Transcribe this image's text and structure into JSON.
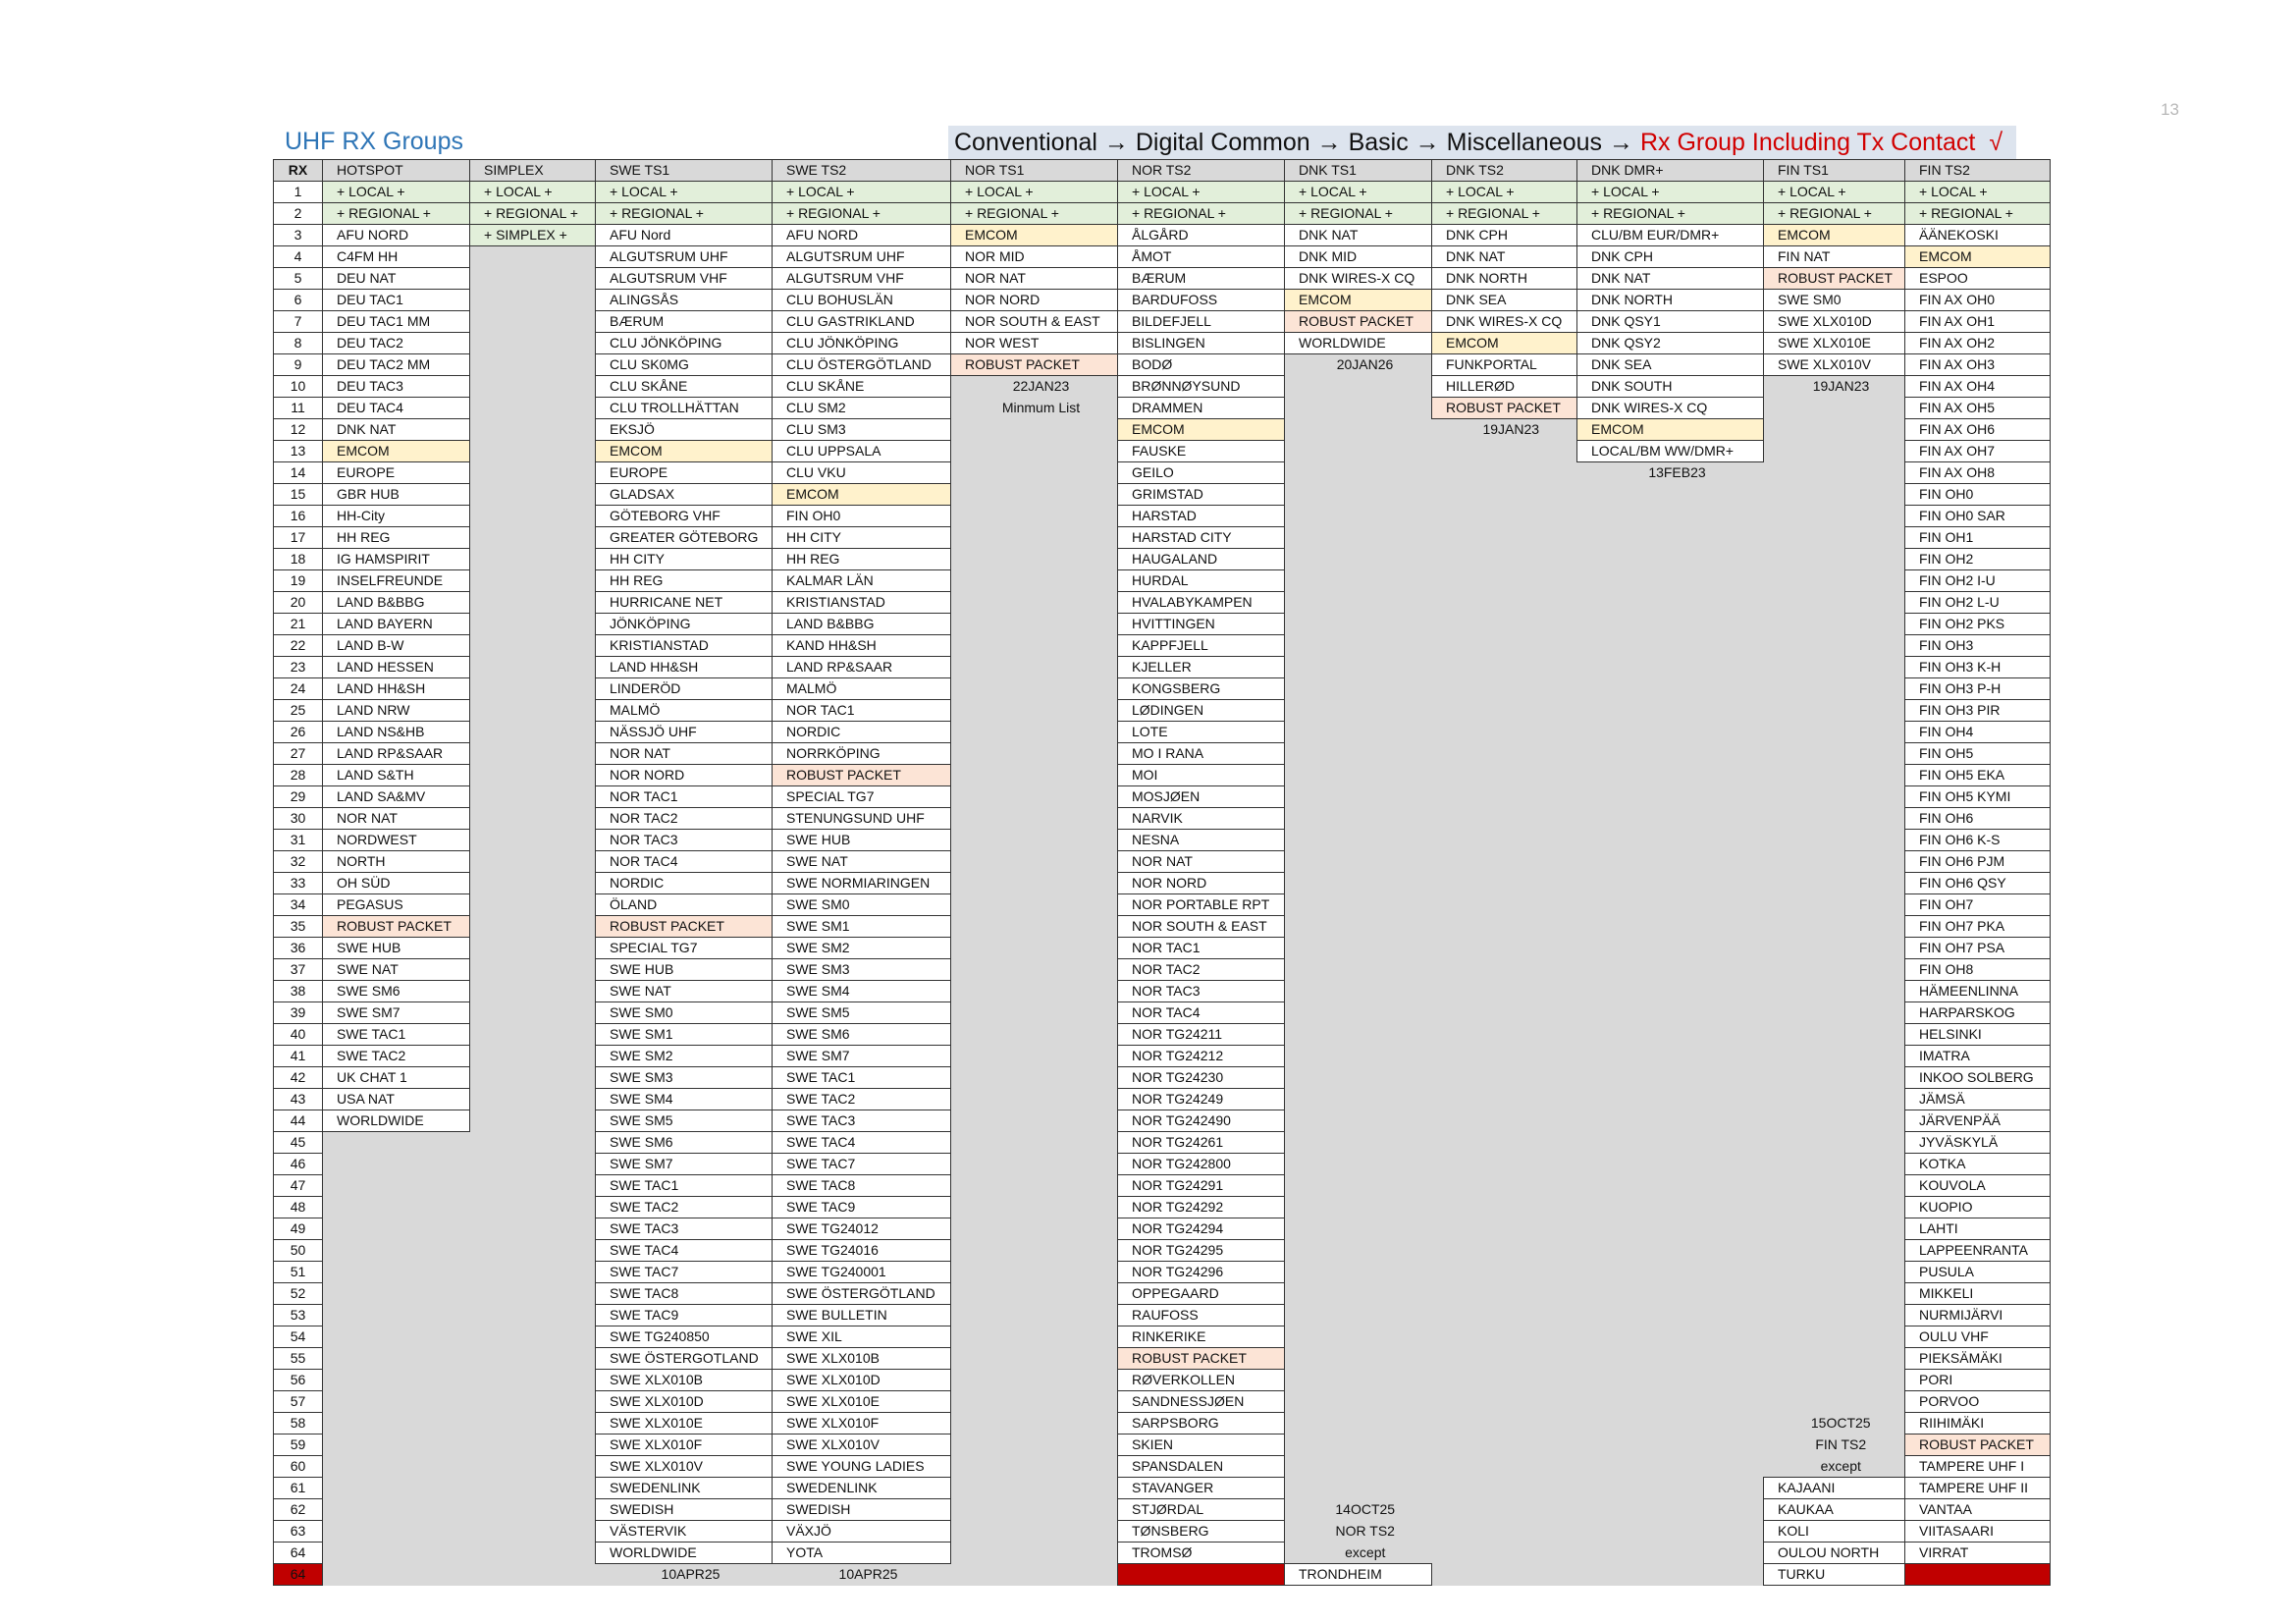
{
  "page_number": "13",
  "title": "UHF RX Groups",
  "menu_path": {
    "p1": "Conventional",
    "p2": "Digital Common",
    "p3": "Basic",
    "p4": "Miscellaneous",
    "highlight": "Rx Group Including Tx Contact",
    "arrow": " → ",
    "check": "√"
  },
  "columns": [
    "RX",
    "HOTSPOT",
    "SIMPLEX",
    "SWE TS1",
    "SWE TS2",
    "NOR TS1",
    "NOR TS2",
    "DNK TS1",
    "DNK TS2",
    "DNK DMR+",
    "FIN TS1",
    "FIN TS2"
  ],
  "lists": [
    [
      "+ LOCAL +",
      "+ REGIONAL +",
      "AFU NORD",
      "C4FM HH",
      "DEU NAT",
      "DEU TAC1",
      "DEU TAC1 MM",
      "DEU TAC2",
      "DEU TAC2 MM",
      "DEU TAC3",
      "DEU TAC4",
      "DNK NAT",
      "EMCOM",
      "EUROPE",
      "GBR HUB",
      "HH-City",
      "HH REG",
      "IG HAMSPIRIT",
      "INSELFREUNDE",
      "LAND B&BBG",
      "LAND BAYERN",
      "LAND B-W",
      "LAND HESSEN",
      "LAND HH&SH",
      "LAND NRW",
      "LAND NS&HB",
      "LAND RP&SAAR",
      "LAND S&TH",
      "LAND SA&MV",
      "NOR NAT",
      "NORDWEST",
      "NORTH",
      "OH SÜD",
      "PEGASUS",
      "ROBUST PACKET",
      "SWE HUB",
      "SWE NAT",
      "SWE SM6",
      "SWE SM7",
      "SWE TAC1",
      "SWE TAC2",
      "UK CHAT 1",
      "USA NAT",
      "WORLDWIDE"
    ],
    [
      "+ LOCAL +",
      "+ REGIONAL +",
      "+ SIMPLEX +"
    ],
    [
      "+ LOCAL +",
      "+ REGIONAL +",
      "AFU Nord",
      "ALGUTSRUM UHF",
      "ALGUTSRUM VHF",
      "ALINGSÅS",
      "BÆRUM",
      "CLU JÖNKÖPING",
      "CLU SK0MG",
      "CLU SKÅNE",
      "CLU TROLLHÄTTAN",
      "EKSJÖ",
      "EMCOM",
      "EUROPE",
      "GLADSAX",
      "GÖTEBORG VHF",
      "GREATER GÖTEBORG",
      "HH CITY",
      "HH REG",
      "HURRICANE NET",
      "JÖNKÖPING",
      "KRISTIANSTAD",
      "LAND HH&SH",
      "LINDERÖD",
      "MALMÖ",
      "NÄSSJÖ UHF",
      "NOR NAT",
      "NOR NORD",
      "NOR TAC1",
      "NOR TAC2",
      "NOR TAC3",
      "NOR TAC4",
      "NORDIC",
      "ÖLAND",
      "ROBUST PACKET",
      "SPECIAL TG7",
      "SWE HUB",
      "SWE NAT",
      "SWE SM0",
      "SWE SM1",
      "SWE SM2",
      "SWE SM3",
      "SWE SM4",
      "SWE SM5",
      "SWE SM6",
      "SWE SM7",
      "SWE TAC1",
      "SWE TAC2",
      "SWE TAC3",
      "SWE TAC4",
      "SWE TAC7",
      "SWE TAC8",
      "SWE TAC9",
      "SWE TG240850",
      "SWE ÖSTERGOTLAND",
      "SWE XLX010B",
      "SWE XLX010D",
      "SWE XLX010E",
      "SWE XLX010F",
      "SWE XLX010V",
      "SWEDENLINK",
      "SWEDISH",
      "VÄSTERVIK",
      "WORLDWIDE"
    ],
    [
      "+ LOCAL +",
      "+ REGIONAL +",
      "AFU NORD",
      "ALGUTSRUM UHF",
      "ALGUTSRUM VHF",
      "CLU BOHUSLÄN",
      "CLU GASTRIKLAND",
      "CLU JÖNKÖPING",
      "CLU ÖSTERGÖTLAND",
      "CLU SKÅNE",
      "CLU SM2",
      "CLU SM3",
      "CLU UPPSALA",
      "CLU VKU",
      "EMCOM",
      "FIN OH0",
      "HH CITY",
      "HH REG",
      "KALMAR LÄN",
      "KRISTIANSTAD",
      "LAND B&BBG",
      "KAND HH&SH",
      "LAND RP&SAAR",
      "MALMÖ",
      "NOR TAC1",
      "NORDIC",
      "NORRKÖPING",
      "ROBUST PACKET",
      "SPECIAL TG7",
      "STENUNGSUND UHF",
      "SWE HUB",
      "SWE NAT",
      "SWE NORMIARINGEN",
      "SWE SM0",
      "SWE SM1",
      "SWE SM2",
      "SWE SM3",
      "SWE SM4",
      "SWE SM5",
      "SWE SM6",
      "SWE SM7",
      "SWE TAC1",
      "SWE TAC2",
      "SWE TAC3",
      "SWE TAC4",
      "SWE TAC7",
      "SWE TAC8",
      "SWE TAC9",
      "SWE TG24012",
      "SWE TG24016",
      "SWE TG240001",
      "SWE ÖSTERGÖTLAND",
      "SWE BULLETIN",
      "SWE XIL",
      "SWE XLX010B",
      "SWE XLX010D",
      "SWE XLX010E",
      "SWE XLX010F",
      "SWE XLX010V",
      "SWE YOUNG LADIES",
      "SWEDENLINK",
      "SWEDISH",
      "VÄXJÖ",
      "YOTA"
    ],
    [
      "+ LOCAL +",
      "+ REGIONAL +",
      "EMCOM",
      "NOR MID",
      "NOR NAT",
      "NOR NORD",
      "NOR SOUTH & EAST",
      "NOR WEST",
      "ROBUST PACKET"
    ],
    [
      "+ LOCAL +",
      "+ REGIONAL +",
      "ÅLGÅRD",
      "ÅMOT",
      "BÆRUM",
      "BARDUFOSS",
      "BILDEFJELL",
      "BISLINGEN",
      "BODØ",
      "BRØNNØYSUND",
      "DRAMMEN",
      "EMCOM",
      "FAUSKE",
      "GEILO",
      "GRIMSTAD",
      "HARSTAD",
      "HARSTAD CITY",
      "HAUGALAND",
      "HURDAL",
      "HVALABYKAMPEN",
      "HVITTINGEN",
      "KAPPFJELL",
      "KJELLER",
      "KONGSBERG",
      "LØDINGEN",
      "LOTE",
      "MO I RANA",
      "MOI",
      "MOSJØEN",
      "NARVIK",
      "NESNA",
      "NOR NAT",
      "NOR NORD",
      "NOR PORTABLE RPT",
      "NOR SOUTH & EAST",
      "NOR TAC1",
      "NOR TAC2",
      "NOR TAC3",
      "NOR TAC4",
      "NOR TG24211",
      "NOR TG24212",
      "NOR TG24230",
      "NOR TG24249",
      "NOR TG242490",
      "NOR TG24261",
      "NOR TG242800",
      "NOR TG24291",
      "NOR TG24292",
      "NOR TG24294",
      "NOR TG24295",
      "NOR TG24296",
      "OPPEGAARD",
      "RAUFOSS",
      "RINKERIKE",
      "ROBUST PACKET",
      "RØVERKOLLEN",
      "SANDNESSJØEN",
      "SARPSBORG",
      "SKIEN",
      "SPANSDALEN",
      "STAVANGER",
      "STJØRDAL",
      "TØNSBERG",
      "TROMSØ"
    ],
    [
      "+ LOCAL +",
      "+ REGIONAL +",
      "DNK NAT",
      "DNK MID",
      "DNK WIRES-X CQ",
      "EMCOM",
      "ROBUST PACKET",
      "WORLDWIDE"
    ],
    [
      "+ LOCAL +",
      "+ REGIONAL +",
      "DNK CPH",
      "DNK NAT",
      "DNK NORTH",
      "DNK SEA",
      "DNK WIRES-X CQ",
      "EMCOM",
      "FUNKPORTAL",
      "HILLERØD",
      "ROBUST PACKET"
    ],
    [
      "+ LOCAL +",
      "+ REGIONAL +",
      "CLU/BM EUR/DMR+",
      "DNK CPH",
      "DNK NAT",
      "DNK NORTH",
      "DNK QSY1",
      "DNK QSY2",
      "DNK SEA",
      "DNK SOUTH",
      "DNK WIRES-X CQ",
      "EMCOM",
      "LOCAL/BM WW/DMR+"
    ],
    [
      "+ LOCAL +",
      "+ REGIONAL +",
      "EMCOM",
      "FIN NAT",
      "ROBUST PACKET",
      "SWE SM0",
      "SWE XLX010D",
      "SWE XLX010E",
      "SWE XLX010V"
    ],
    [
      "+ LOCAL +",
      "+ REGIONAL +",
      "ÄÄNEKOSKI",
      "EMCOM",
      "ESPOO",
      "FIN AX OH0",
      "FIN AX OH1",
      "FIN AX OH2",
      "FIN AX OH3",
      "FIN AX OH4",
      "FIN AX OH5",
      "FIN AX OH6",
      "FIN AX OH7",
      "FIN AX OH8",
      "FIN OH0",
      "FIN OH0 SAR",
      "FIN OH1",
      "FIN OH2",
      "FIN OH2 I-U",
      "FIN OH2 L-U",
      "FIN OH2 PKS",
      "FIN OH3",
      "FIN OH3 K-H",
      "FIN OH3 P-H",
      "FIN OH3 PIR",
      "FIN OH4",
      "FIN OH5",
      "FIN OH5 EKA",
      "FIN OH5 KYMI",
      "FIN OH6",
      "FIN OH6 K-S",
      "FIN OH6 PJM",
      "FIN OH6 QSY",
      "FIN OH7",
      "FIN OH7 PKA",
      "FIN OH7 PSA",
      "FIN OH8",
      "HÄMEENLINNA",
      "HARPARSKOG",
      "HELSINKI",
      "IMATRA",
      "INKOO SOLBERG",
      "JÄMSÄ",
      "JÄRVENPÄÄ",
      "JYVÄSKYLÄ",
      "KOTKA",
      "KOUVOLA",
      "KUOPIO",
      "LAHTI",
      "LAPPEENRANTA",
      "PUSULA",
      "MIKKELI",
      "NURMIJÄRVI",
      "OULU VHF",
      "PIEKSÄMÄKI",
      "PORI",
      "PORVOO",
      "RIIHIMÄKI",
      "ROBUST PACKET",
      "TAMPERE UHF I",
      "TAMPERE UHF II",
      "VANTAA",
      "VIITASAARI",
      "VIRRAT"
    ]
  ],
  "notes": {
    "swe_ts1": [
      "10APR25"
    ],
    "swe_ts2": [
      "10APR25"
    ],
    "nor_ts1": [
      "22JAN23",
      "Minmum List"
    ],
    "dnk_ts1_a": [
      "20JAN26"
    ],
    "dnk_ts1_b": [
      "14OCT25",
      "NOR TS2",
      "except",
      "TRONDHEIM"
    ],
    "dnk_ts2": [
      "19JAN23"
    ],
    "dnk_dmr": [
      "13FEB23"
    ],
    "fin_ts1_a": [
      "19JAN23"
    ],
    "fin_ts1_b": [
      "15OCT25",
      "FIN TS2",
      "except",
      "KAJAANI",
      "KAUKAA",
      "KOLI",
      "OULOU NORTH",
      "TURKU"
    ],
    "footer_rx": "64"
  },
  "colors": {
    "local_regional": "#e2efda",
    "emcom": "#fff2cc",
    "robust_packet": "#fce4d6",
    "missing_red": "#c00000",
    "exception_text": "#d10000",
    "title_blue": "#2e75b6"
  }
}
